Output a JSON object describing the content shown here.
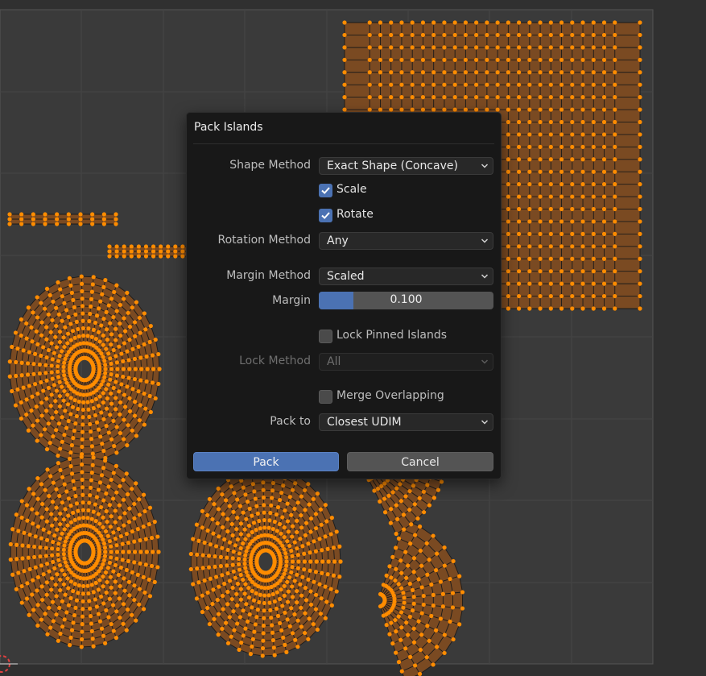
{
  "dialog": {
    "title": "Pack Islands",
    "shape_method": {
      "label": "Shape Method",
      "value": "Exact Shape (Concave)"
    },
    "scale": {
      "label": "Scale",
      "checked": true
    },
    "rotate": {
      "label": "Rotate",
      "checked": true
    },
    "rotation_method": {
      "label": "Rotation Method",
      "value": "Any"
    },
    "margin_method": {
      "label": "Margin Method",
      "value": "Scaled"
    },
    "margin": {
      "label": "Margin",
      "value": "0.100",
      "fill_fraction": 0.1
    },
    "lock_pinned": {
      "label": "Lock Pinned Islands",
      "checked": false
    },
    "lock_method": {
      "label": "Lock Method",
      "value": "All",
      "disabled": true
    },
    "merge_overlapping": {
      "label": "Merge Overlapping",
      "checked": false
    },
    "pack_to": {
      "label": "Pack to",
      "value": "Closest UDIM"
    },
    "pack_button": "Pack",
    "cancel_button": "Cancel"
  },
  "colors": {
    "accent": "#4b72b3",
    "uv_vertex": "#ff8c00",
    "uv_face": "#7a4a22",
    "background": "#303030",
    "dialog_bg": "#181818"
  },
  "icons": {
    "chevron": "chevron-down-icon",
    "checkmark": "checkmark-icon",
    "cursor": "cursor-icon"
  }
}
